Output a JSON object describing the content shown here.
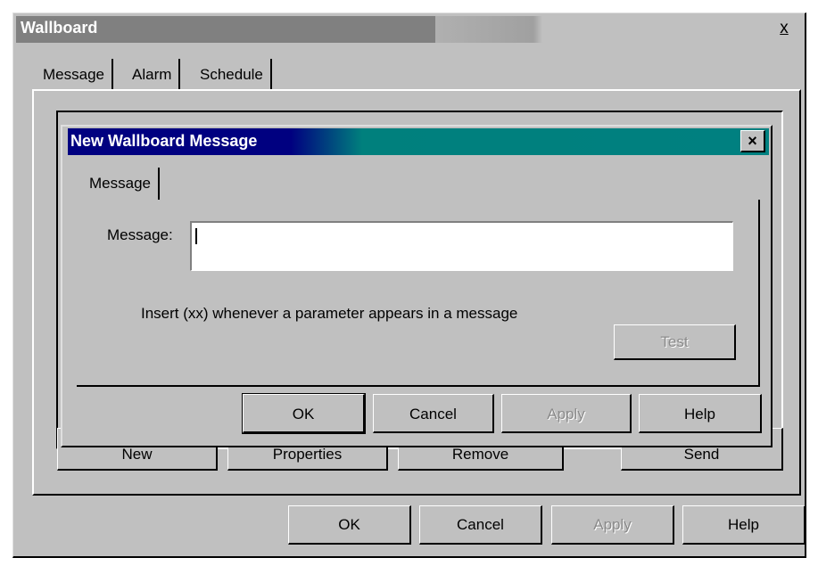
{
  "outer": {
    "title": "Wallboard",
    "close_glyph": "x",
    "tabs": [
      "Message",
      "Alarm",
      "Schedule"
    ],
    "list_buttons": [
      "New",
      "Properties",
      "Remove",
      "Send"
    ],
    "footer_buttons": {
      "ok": "OK",
      "cancel": "Cancel",
      "apply": "Apply",
      "help": "Help"
    }
  },
  "dialog": {
    "title": "New Wallboard Message",
    "close_glyph": "×",
    "tab": "Message",
    "message_label": "Message:",
    "message_value": "",
    "hint": "Insert (xx) whenever a parameter appears in a message",
    "test_label": "Test",
    "buttons": {
      "ok": "OK",
      "cancel": "Cancel",
      "apply": "Apply",
      "help": "Help"
    }
  },
  "colors": {
    "dialog_title_start": "#000080",
    "dialog_title_end": "#008080",
    "face": "#c0c0c0"
  }
}
